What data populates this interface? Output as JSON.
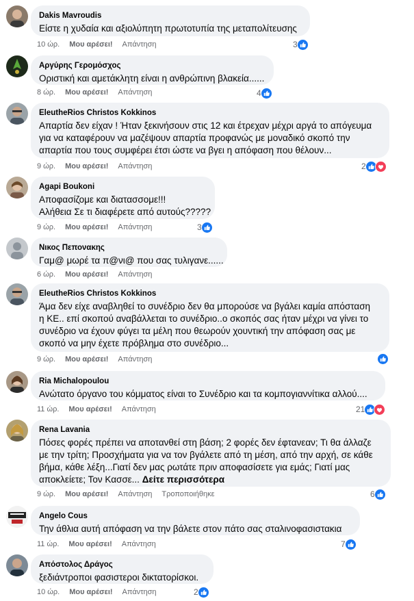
{
  "actions": {
    "like": "Μου αρέσει!",
    "reply": "Απάντηση",
    "edited": "Τροποποιήθηκε",
    "see_more": "Δείτε περισσότερα"
  },
  "colors": {
    "like_blue": "#1877f2",
    "love_red": "#f33e58",
    "bubble": "#f0f2f5",
    "meta_gray": "#65676b"
  },
  "comments": [
    {
      "author": "Dakis Mavroudis",
      "lines": [
        "Είστε η χυδαία και αξιολύπητη πρωτοτυπία της μεταπολίτευσης"
      ],
      "time": "10 ώρ.",
      "reaction_count": "3",
      "reactions": [
        "like-icon"
      ]
    },
    {
      "author": "Αργύρης Γερομόσχος",
      "lines": [
        "Οριστική και αμετάκλητη είναι η ανθρώπινη βλακεία......"
      ],
      "time": "8 ώρ.",
      "reaction_count": "4",
      "reactions": [
        "like-icon"
      ]
    },
    {
      "author": "EleutheRios Christos Kokkinos",
      "lines": [
        "Απαρτία δεν είχαν ! Ήταν ξεκινήσουν στις 12 και έτρεχαν μέχρι αργά το απόγευμα",
        "για να καταφέρουν να μαζέψουν απαρτία προφανώς με μοναδικό σκοπό την",
        "απαρτία που τους συμφέρει έτσι ώστε να βγει η απόφαση που θέλουν..."
      ],
      "time": "9 ώρ.",
      "reaction_count": "2",
      "reactions": [
        "like-icon",
        "love-icon"
      ]
    },
    {
      "author": "Agapi Boukoni",
      "lines": [
        "Αποφασίζομε και διατασσομε!!!",
        "Αλήθεια Σε τι διαφέρετε από αυτούς?????"
      ],
      "time": "9 ώρ.",
      "reaction_count": "3",
      "reactions": [
        "like-icon"
      ]
    },
    {
      "author": "Νικος Πεπονακης",
      "lines": [
        "Γαμ@ μωρέ τα π@νι@ που σας τυλιγανε......"
      ],
      "time": "6 ώρ.",
      "reaction_count": "",
      "reactions": []
    },
    {
      "author": "EleutheRios Christos Kokkinos",
      "lines": [
        "Άμα δεν είχε αναβληθεί το συνέδριο δεν θα μπορούσε να βγάλει καμία απόσταση",
        "η ΚΕ.. επί σκοπού αναβάλλεται το συνέδριο..ο σκοπός σας ήταν μέχρι να γίνει το",
        "συνέδριο να έχουν φύγει τα μέλη που θεωρούν χουντική την απόφαση σας με",
        "σκοπό να μην έχετε πρόβλημα στο συνέδριο..."
      ],
      "time": "9 ώρ.",
      "reaction_count": "",
      "reactions": [
        "like-icon"
      ]
    },
    {
      "author": "Ria Michalopoulou",
      "lines": [
        "Ανώτατο όργανο του κόμματος είναι το Συνέδριο και τα κομπογιαννίτικα αλλού...."
      ],
      "time": "11 ώρ.",
      "reaction_count": "21",
      "reactions": [
        "like-icon",
        "love-icon"
      ]
    },
    {
      "author": "Rena Lavania",
      "lines": [
        "Πόσες φορές πρέπει να αποτανθεί στη βάση; 2 φορές δεν έφτανεαν; Τι θα άλλαζε",
        "με την τρίτη; Προσχήματα για να τον βγάλετε από τη μέση, από την αρχή, σε κάθε",
        "βήμα, κάθε λέξη...Γιατί δεν μας ρωτάτε πριν αποφασίσετε για εμάς; Γιατί μας",
        "αποκλείετε; Τον Κασσε..."
      ],
      "time": "9 ώρ.",
      "reaction_count": "6",
      "reactions": [
        "like-icon"
      ],
      "edited": true
    },
    {
      "author": "Angelo Cous",
      "lines": [
        "Την άθλια αυτή απόφαση να την βάλετε στον πάτο σας σταλινοφασιστακια"
      ],
      "time": "11 ώρ.",
      "reaction_count": "7",
      "reactions": [
        "like-icon"
      ]
    },
    {
      "author": "Απόστολος Δράγος",
      "lines": [
        "ξεδιάντροποι φασιστεροι δικτατορίσκοι."
      ],
      "time": "10 ώρ.",
      "reaction_count": "2",
      "reactions": [
        "like-icon"
      ]
    }
  ]
}
